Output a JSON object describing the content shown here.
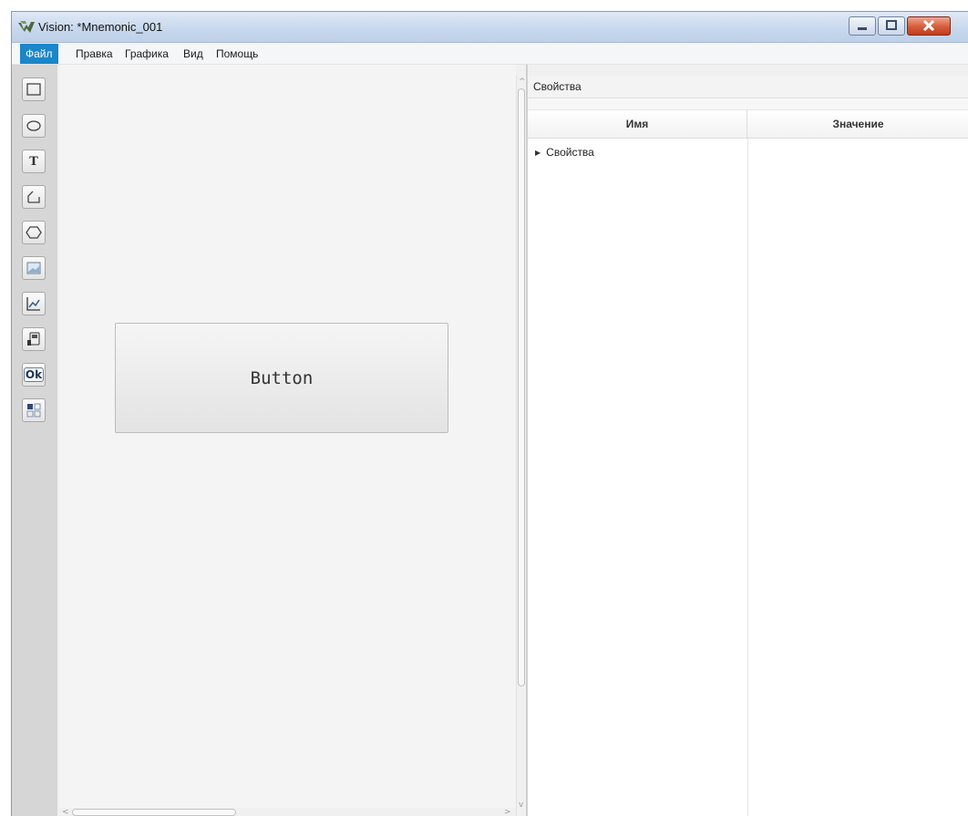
{
  "window": {
    "title": "Vision: *Mnemonic_001",
    "controls": [
      "minimize-icon",
      "maximize-icon",
      "close-icon"
    ],
    "accent": "#1b86c9"
  },
  "menu": {
    "items": [
      {
        "label": "Файл",
        "active": true
      },
      {
        "label": "Правка"
      },
      {
        "label": "Графика"
      },
      {
        "label": "Вид"
      },
      {
        "label": "Помощь"
      }
    ]
  },
  "toolbox": {
    "tools": [
      "rectangle-icon",
      "ellipse-icon",
      "text-icon",
      "polyline-icon",
      "polygon-icon",
      "image-icon",
      "chart-icon",
      "device-icon",
      "ok-button-icon",
      "grid-widget-icon"
    ],
    "ok_label": "Ok",
    "text_label": "T"
  },
  "canvas": {
    "button_label": "Button"
  },
  "properties": {
    "header": "Свойства",
    "columns": {
      "name": "Имя",
      "value": "Значение"
    },
    "rows": [
      {
        "label": "Свойства",
        "expanded": false
      }
    ]
  }
}
